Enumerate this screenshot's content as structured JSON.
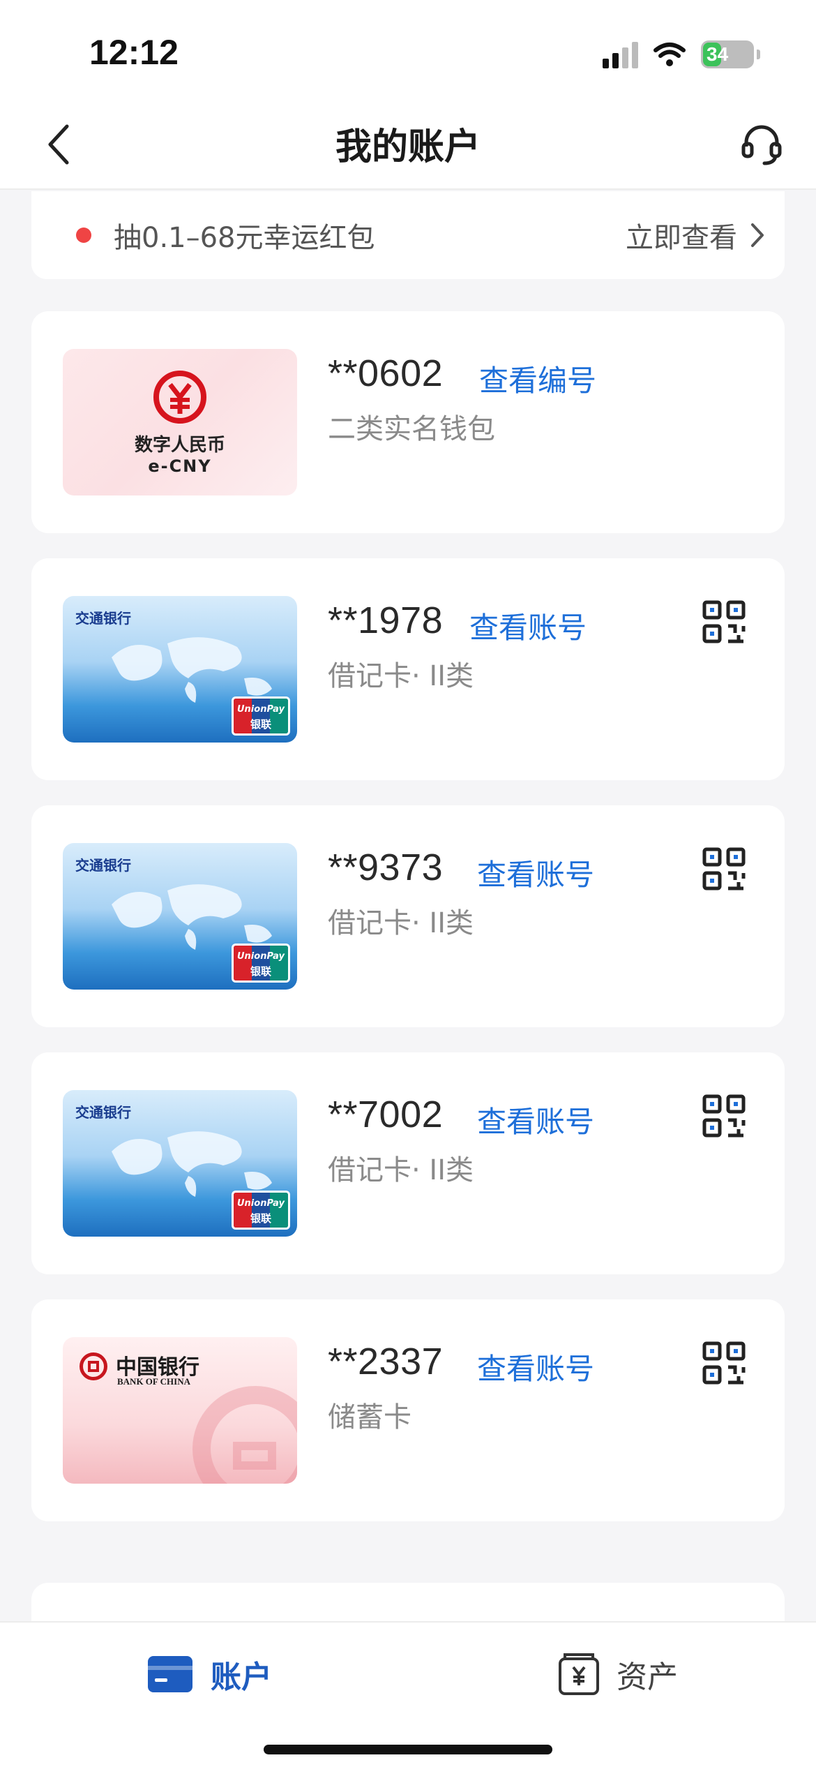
{
  "status_bar": {
    "time": "12:12",
    "battery": "34"
  },
  "nav": {
    "title": "我的账户"
  },
  "banner": {
    "text": "抽0.1–68元幸运红包",
    "action": "立即查看"
  },
  "accounts": [
    {
      "number": "**0602",
      "view_label": "查看编号",
      "subtitle": "二类实名钱包",
      "card_text_1": "数字人民币",
      "card_text_2": "e-CNY"
    },
    {
      "number": "**1978",
      "view_label": "查看账号",
      "subtitle": "借记卡· II类",
      "bank_name": "交通银行"
    },
    {
      "number": "**9373",
      "view_label": "查看账号",
      "subtitle": "借记卡· II类",
      "bank_name": "交通银行"
    },
    {
      "number": "**7002",
      "view_label": "查看账号",
      "subtitle": "借记卡· II类",
      "bank_name": "交通银行"
    },
    {
      "number": "**2337",
      "view_label": "查看账号",
      "subtitle": "储蓄卡",
      "bank_name": "中国银行",
      "bank_name_en": "BANK OF CHINA"
    }
  ],
  "unionpay": {
    "top": "UnionPay",
    "bottom": "银联"
  },
  "tabs": {
    "accounts": "账户",
    "assets": "资产"
  },
  "colors": {
    "accent": "#1e6fd9",
    "tab_active": "#1e5cbf",
    "alert_dot": "#ef4444"
  }
}
